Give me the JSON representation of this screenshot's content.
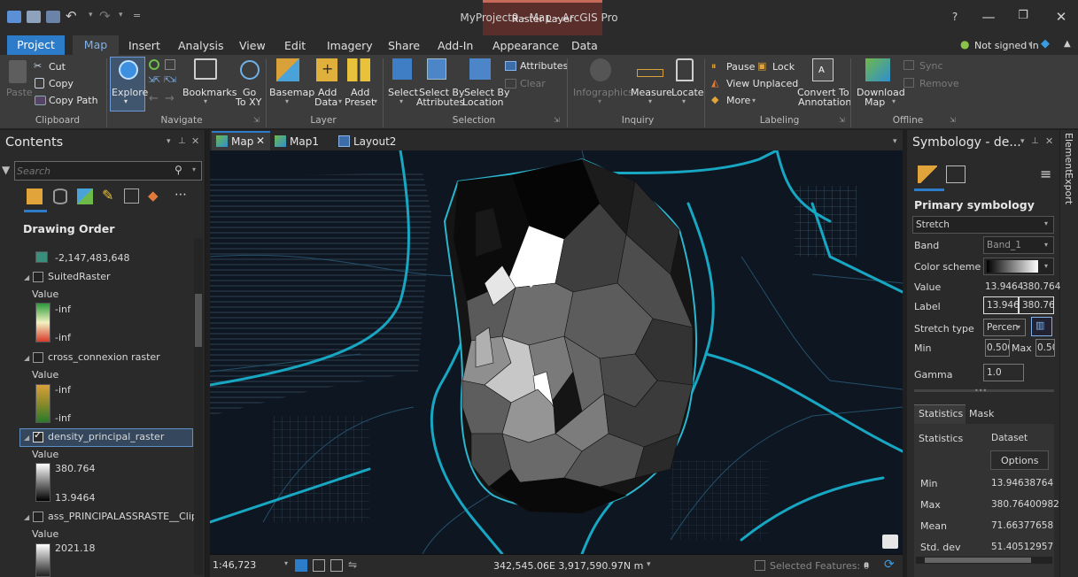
{
  "window": {
    "title": "MyProject9 - Map - ArcGIS Pro",
    "context_tab": "Raster Layer",
    "help": "?",
    "minimize": "—",
    "restore": "❐",
    "close": "✕"
  },
  "tabs": [
    "Project",
    "Map",
    "Insert",
    "Analysis",
    "View",
    "Edit",
    "Imagery",
    "Share",
    "Add-In",
    "Appearance",
    "Data"
  ],
  "account": {
    "label": "Not signed in"
  },
  "ribbon": {
    "clipboard": {
      "paste": "Paste",
      "cut": "Cut",
      "copy": "Copy",
      "copy_path": "Copy Path",
      "group": "Clipboard"
    },
    "navigate": {
      "explore": "Explore",
      "bookmarks": "Bookmarks",
      "go_to_xy_1": "Go",
      "go_to_xy_2": "To XY",
      "group": "Navigate"
    },
    "layer": {
      "basemap": "Basemap",
      "add_data_1": "Add",
      "add_data_2": "Data",
      "add_preset_1": "Add",
      "add_preset_2": "Preset",
      "group": "Layer"
    },
    "selection": {
      "select": "Select",
      "by_attr_1": "Select By",
      "by_attr_2": "Attributes",
      "by_loc_1": "Select By",
      "by_loc_2": "Location",
      "attributes": "Attributes",
      "clear": "Clear",
      "group": "Selection"
    },
    "inquiry": {
      "infographics": "Infographics",
      "measure": "Measure",
      "locate": "Locate",
      "group": "Inquiry"
    },
    "labeling": {
      "pause": "Pause",
      "lock": "Lock",
      "view_unplaced": "View Unplaced",
      "more": "More",
      "convert_1": "Convert To",
      "convert_2": "Annotation",
      "group": "Labeling"
    },
    "offline": {
      "download_1": "Download",
      "download_2": "Map",
      "sync": "Sync",
      "remove": "Remove",
      "group": "Offline"
    }
  },
  "contents": {
    "title": "Contents",
    "search_placeholder": "Search",
    "drawing_order": "Drawing Order",
    "items": [
      {
        "type": "swatch",
        "label": "-2,147,483,648"
      },
      {
        "type": "layer",
        "name": "SuitedRaster",
        "checked": false,
        "value_label": "Value",
        "high": "-inf",
        "low": "-inf"
      },
      {
        "type": "layer",
        "name": "cross_connexion raster",
        "checked": false,
        "value_label": "Value",
        "high": "-inf",
        "low": "-inf"
      },
      {
        "type": "layer",
        "name": "density_principal_raster",
        "checked": true,
        "value_label": "Value",
        "high": "380.764",
        "low": "13.9464"
      },
      {
        "type": "layer",
        "name": "ass_PRINCIPALASSRASTE__Clip",
        "checked": false,
        "value_label": "Value",
        "high": "2021.18"
      }
    ]
  },
  "map_tabs": [
    {
      "label": "Map",
      "active": true,
      "closable": true
    },
    {
      "label": "Map1",
      "active": false
    },
    {
      "label": "Layout2",
      "active": false
    }
  ],
  "status": {
    "scale": "1:46,723",
    "coordinates": "342,545.06E 3,917,590.97N m",
    "selected": "Selected Features: 0"
  },
  "symbology": {
    "title": "Symbology - de...",
    "primary": "Primary symbology",
    "renderer": "Stretch",
    "band_label": "Band",
    "band_value": "Band_1",
    "color_scheme_label": "Color scheme",
    "value_label": "Value",
    "value_min": "13.9464",
    "value_max": "380.764",
    "label_label": "Label",
    "label_min": "13.9464",
    "label_max": "380.764",
    "stretch_label": "Stretch type",
    "stretch_value": "Percen",
    "min_label": "Min",
    "min_value": "0.500",
    "max_label": "Max",
    "max_value": "0.50",
    "gamma_label": "Gamma",
    "gamma_value": "1.0",
    "tab_statistics": "Statistics",
    "tab_mask": "Mask",
    "statistics_label": "Statistics",
    "dataset_value": "Dataset",
    "options_button": "Options",
    "stats": [
      {
        "label": "Min",
        "value": "13.94638764"
      },
      {
        "label": "Max",
        "value": "380.76400982"
      },
      {
        "label": "Mean",
        "value": "71.66377658"
      },
      {
        "label": "Std. dev",
        "value": "51.40512957"
      }
    ]
  },
  "side_tabs": [
    "Element",
    "Export"
  ],
  "colors": {
    "accent": "#2c7cc9",
    "context_tab": "#5a2e2a",
    "road": "#18a7c2",
    "map_bg": "#0e1621"
  }
}
